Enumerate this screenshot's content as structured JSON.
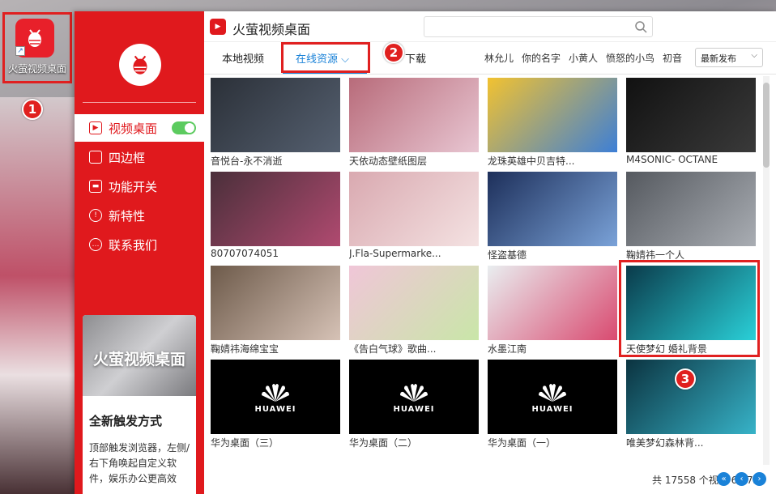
{
  "desktop": {
    "icon_label": "火萤视频桌面"
  },
  "markers": [
    "1",
    "2",
    "3"
  ],
  "app": {
    "title": "火萤视频桌面",
    "search_placeholder": ""
  },
  "sidebar": {
    "items": [
      {
        "label": "视频桌面",
        "icon": "play-icon",
        "toggle_on": true
      },
      {
        "label": "四边框",
        "icon": "frame-icon"
      },
      {
        "label": "功能开关",
        "icon": "switch-icon"
      },
      {
        "label": "新特性",
        "icon": "bulb-icon"
      },
      {
        "label": "联系我们",
        "icon": "chat-icon"
      }
    ],
    "promo": {
      "title": "火萤视频桌面",
      "subtitle": "全新触发方式",
      "description": "顶部触发浏览器，左侧/右下角唤起自定义软件，娱乐办公更高效"
    }
  },
  "tabs": {
    "local": "本地视频",
    "online": "在线资源",
    "download": "下载"
  },
  "tags": [
    "林允儿",
    "你的名字",
    "小黄人",
    "愤怒的小鸟",
    "初音"
  ],
  "sort": {
    "selected": "最新发布"
  },
  "videos": [
    {
      "caption": "音悦台-永不消逝",
      "thumb": [
        "#2b3038",
        "#556070"
      ]
    },
    {
      "caption": "天依动态壁纸图层",
      "thumb": [
        "#b86b7a",
        "#e8c6d2"
      ]
    },
    {
      "caption": "龙珠英雄中贝吉特...",
      "thumb": [
        "#f2c230",
        "#3d7fd6"
      ]
    },
    {
      "caption": "M4SONIC- OCTANE",
      "thumb": [
        "#111111",
        "#3a3a3a"
      ]
    },
    {
      "caption": "80707074051",
      "thumb": [
        "#4a2f3a",
        "#b04a70"
      ]
    },
    {
      "caption": "J.Fla-Supermarke...",
      "thumb": [
        "#d9a9b0",
        "#f4e2e2"
      ]
    },
    {
      "caption": "怪盗基德",
      "thumb": [
        "#1d2f5a",
        "#7aa2d8"
      ]
    },
    {
      "caption": "鞠婧祎一个人",
      "thumb": [
        "#55595f",
        "#a9adb3"
      ]
    },
    {
      "caption": "鞠婧祎海绵宝宝",
      "thumb": [
        "#6d5a4a",
        "#d6c2b6"
      ]
    },
    {
      "caption": "《告白气球》歌曲...",
      "thumb": [
        "#f0c6d8",
        "#c9e6a8"
      ]
    },
    {
      "caption": "水墨江南",
      "thumb": [
        "#e9eef0",
        "#d94a70"
      ]
    },
    {
      "caption": "天使梦幻  婚礼背景",
      "thumb": [
        "#0a3a4a",
        "#2ad0d8"
      ]
    },
    {
      "caption": "华为桌面（三）",
      "thumb": [
        "#000000",
        "#000000"
      ],
      "huawei": true
    },
    {
      "caption": "华为桌面（二）",
      "thumb": [
        "#000000",
        "#000000"
      ],
      "huawei": true
    },
    {
      "caption": "华为桌面（一）",
      "thumb": [
        "#000000",
        "#000000"
      ],
      "huawei": true
    },
    {
      "caption": "唯美梦幻森林背...",
      "thumb": [
        "#0b3340",
        "#37b3c8"
      ]
    }
  ],
  "huawei_logo_text": "HUAWEI",
  "status": {
    "text": "共 17558 个视频  6/272"
  },
  "colors": {
    "brand_red": "#e0191d",
    "accent_blue": "#1a82d8",
    "toggle_green": "#5ccb5f"
  }
}
